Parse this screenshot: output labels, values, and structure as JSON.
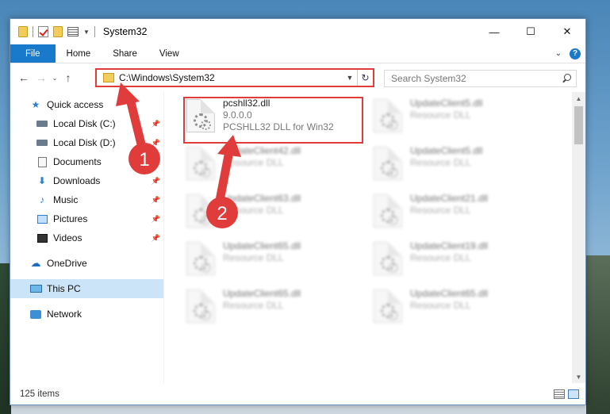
{
  "window": {
    "title": "System32",
    "controls": {
      "minimize": "—",
      "maximize": "☐",
      "close": "✕"
    }
  },
  "ribbon": {
    "tabs": [
      "File",
      "Home",
      "Share",
      "View"
    ],
    "help": "?"
  },
  "address": {
    "path": "C:\\Windows\\System32",
    "search_placeholder": "Search System32"
  },
  "sidebar": {
    "items": [
      {
        "label": "Quick access",
        "icon": "star-icon",
        "pinned": false
      },
      {
        "label": "Local Disk (C:)",
        "icon": "disk-icon",
        "pinned": true
      },
      {
        "label": "Local Disk (D:)",
        "icon": "disk-icon",
        "pinned": true
      },
      {
        "label": "Documents",
        "icon": "document-icon",
        "pinned": true
      },
      {
        "label": "Downloads",
        "icon": "download-icon",
        "pinned": true
      },
      {
        "label": "Music",
        "icon": "music-icon",
        "pinned": true
      },
      {
        "label": "Pictures",
        "icon": "picture-icon",
        "pinned": true
      },
      {
        "label": "Videos",
        "icon": "video-icon",
        "pinned": true
      },
      {
        "label": "OneDrive",
        "icon": "cloud-icon"
      },
      {
        "label": "This PC",
        "icon": "computer-icon",
        "selected": true
      },
      {
        "label": "Network",
        "icon": "network-icon"
      }
    ]
  },
  "files": {
    "focused": {
      "name": "pcshll32.dll",
      "version": "9.0.0.0",
      "description": "PCSHLL32 DLL for Win32"
    },
    "blurred": [
      {
        "name": "UpdateClient5.dll",
        "type": "Resource DLL"
      },
      {
        "name": "UpdateClient42.dll",
        "type": "Resource DLL"
      },
      {
        "name": "UpdateClient5.dll",
        "type": "Resource DLL"
      },
      {
        "name": "UpdateClient63.dll",
        "type": "Resource DLL"
      },
      {
        "name": "UpdateClient21.dll",
        "type": "Resource DLL"
      },
      {
        "name": "UpdateClient65.dll",
        "type": "Resource DLL"
      },
      {
        "name": "UpdateClient19.dll",
        "type": "Resource DLL"
      },
      {
        "name": "UpdateClient65.dll",
        "type": "Resource DLL"
      },
      {
        "name": "UpdateClient65.dll",
        "type": "Resource DLL"
      }
    ]
  },
  "status": {
    "item_count": "125 items"
  },
  "annotations": {
    "step1": "1",
    "step2": "2",
    "color": "#e03c3c"
  }
}
